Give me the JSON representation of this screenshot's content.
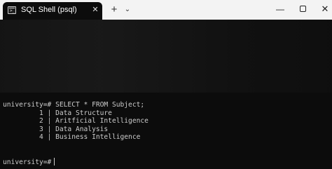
{
  "window": {
    "tab_title": "SQL Shell (psql)",
    "tab_icon_glyph": ">_",
    "tab_close": "✕",
    "new_tab": "+",
    "dropdown": "⌄",
    "minimize": "—",
    "close": "✕"
  },
  "terminal": {
    "command_prompt": "university=#",
    "command": "SELECT * FROM Subject;",
    "rows": [
      "         1 | Data Structure",
      "         2 | Aritficial Intelligence",
      "         3 | Data Analysis",
      "         4 | Business Intelligence"
    ],
    "current_prompt": "university=#"
  },
  "colors": {
    "terminal_bg": "#0c0c0c",
    "terminal_text": "#cccccc",
    "titlebar_bg": "#f3f3f3"
  }
}
